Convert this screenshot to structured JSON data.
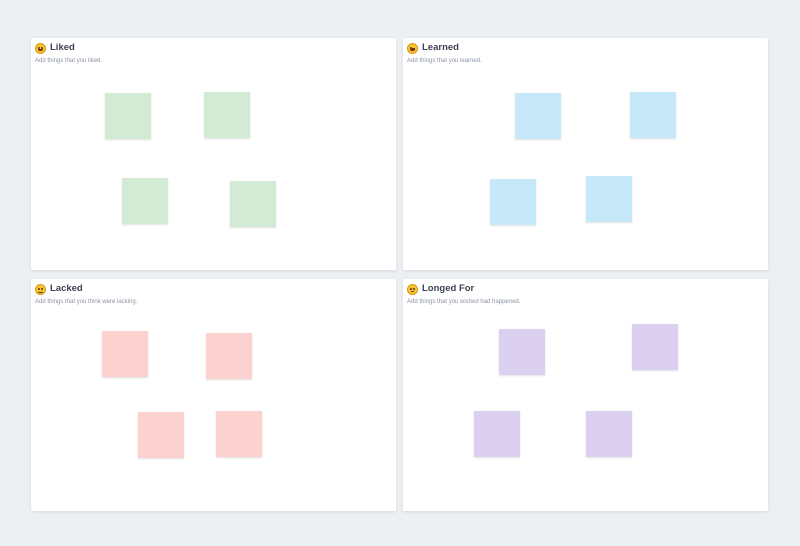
{
  "colors": {
    "background": "#edf0f3",
    "panel": "#ffffff",
    "liked_note": "#d3ebd4",
    "learned_note": "#c6e8f9",
    "lacked_note": "#fcd2d0",
    "longed_note": "#dbd0ef"
  },
  "panels": {
    "liked": {
      "icon": "grinning-face-emoji",
      "title": "Liked",
      "subtitle": "Add things that you liked.",
      "note_count": 4
    },
    "learned": {
      "icon": "winking-face-emoji",
      "title": "Learned",
      "subtitle": "Add things that you learned.",
      "note_count": 4
    },
    "lacked": {
      "icon": "disappointed-face-emoji",
      "title": "Lacked",
      "subtitle": "Add things that you think were lacking.",
      "note_count": 4
    },
    "longed": {
      "icon": "thinking-face-emoji",
      "title": "Longed For",
      "subtitle": "Add things that you wished had happened.",
      "note_count": 4
    }
  }
}
